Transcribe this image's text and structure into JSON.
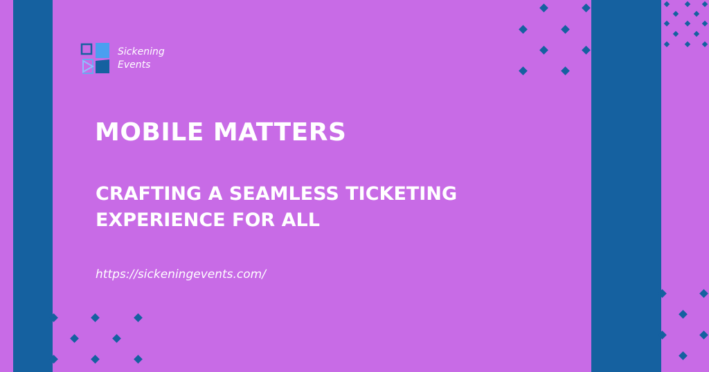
{
  "brand": {
    "name_line1": "Sickening",
    "name_line2": "Events",
    "logo_icon": "sickening-events-logo-icon"
  },
  "headline": "MOBILE MATTERS",
  "subheadline": {
    "line1": "CRAFTING A SEAMLESS TICKETING",
    "line2": "EXPERIENCE FOR ALL"
  },
  "url": "https://sickeningevents.com/",
  "colors": {
    "background": "#c86be6",
    "accent_blue": "#1561a0",
    "light_blue": "#4a9ff0",
    "text": "#ffffff"
  }
}
